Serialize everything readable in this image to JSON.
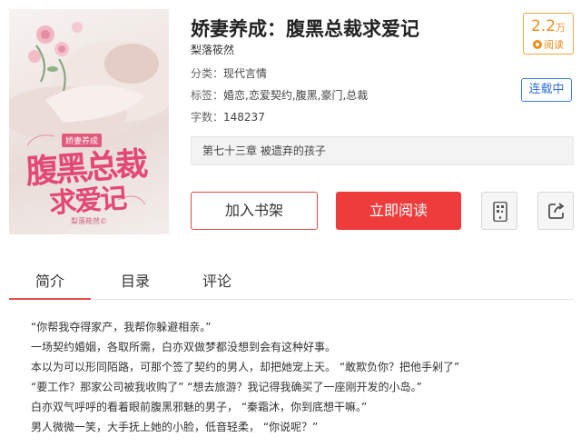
{
  "book": {
    "title": "娇妻养成：腹黑总裁求爱记",
    "author": "梨落筱然",
    "category_label": "分类：",
    "category": "现代言情",
    "tags_label": "标签：",
    "tags": "婚恋,恋爱契约,腹黑,豪门,总裁",
    "words_label": "字数：",
    "words": "148237",
    "reads_number": "2.2",
    "reads_unit": "万",
    "reads_label": "阅读",
    "status": "连载中",
    "latest_chapter": "第七十三章 被遗弃的孩子"
  },
  "cover": {
    "small_tag": "娇妻养成",
    "title_line1": "腹黑总裁",
    "title_line2": "求爱记",
    "author_mark": "梨落筱然©"
  },
  "actions": {
    "shelf": "加入书架",
    "read": "立即阅读",
    "phone_icon": "mobile-qr-icon",
    "share_icon": "share-icon"
  },
  "tabs": [
    {
      "label": "简介",
      "active": true
    },
    {
      "label": "目录",
      "active": false
    },
    {
      "label": "评论",
      "active": false
    }
  ],
  "intro": [
    "“你帮我夺得家产，我帮你躲避相亲。”",
    "一场契约婚姻，各取所需，白亦双做梦都没想到会有这种好事。",
    "本以为可以形同陌路，可那个签了契约的男人，却把她宠上天。 “敢欺负你？把他手剁了”",
    "“要工作？那家公司被我收购了” “想去旅游？我记得我确买了一座刚开发的小岛。”",
    "白亦双气呼呼的看着眼前腹黑邪魅的男子， “秦霜沐，你到底想干嘛。”",
    "男人微微一笑，大手抚上她的小脸，低音轻柔， “你说呢？”"
  ],
  "colors": {
    "accent_red": "#ee3b3b",
    "reads_orange": "#f08c1a",
    "status_blue": "#2f6fd6"
  }
}
